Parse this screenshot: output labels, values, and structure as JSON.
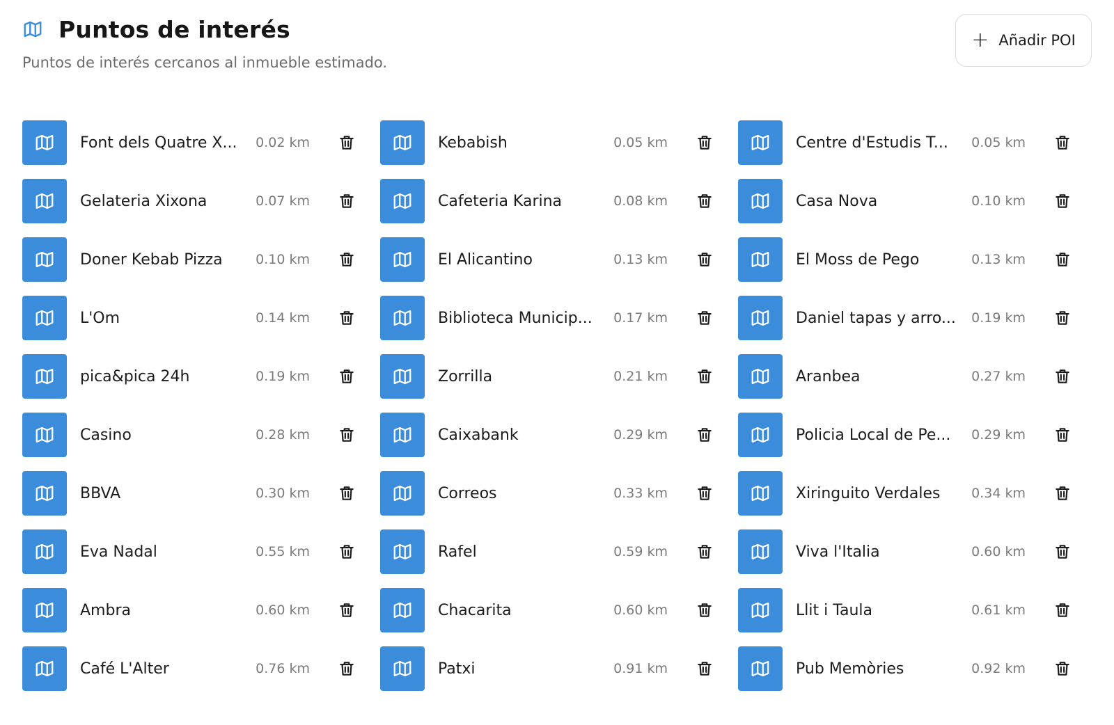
{
  "header": {
    "title": "Puntos de interés",
    "title_icon": "map-icon",
    "subtitle": "Puntos de interés cercanos al inmueble estimado.",
    "add_button_label": "Añadir POI"
  },
  "colors": {
    "accent": "#3b8ddb",
    "text": "#1a1a1a",
    "muted": "#7a7a7a"
  },
  "pois": [
    {
      "name": "Font dels Quatre X...",
      "distance": "0.02 km"
    },
    {
      "name": "Kebabish",
      "distance": "0.05 km"
    },
    {
      "name": "Centre d'Estudis T...",
      "distance": "0.05 km"
    },
    {
      "name": "Gelateria Xixona",
      "distance": "0.07 km"
    },
    {
      "name": "Cafeteria Karina",
      "distance": "0.08 km"
    },
    {
      "name": "Casa Nova",
      "distance": "0.10 km"
    },
    {
      "name": "Doner Kebab Pizza",
      "distance": "0.10 km"
    },
    {
      "name": "El Alicantino",
      "distance": "0.13 km"
    },
    {
      "name": "El Moss de Pego",
      "distance": "0.13 km"
    },
    {
      "name": "L'Om",
      "distance": "0.14 km"
    },
    {
      "name": "Biblioteca Municip...",
      "distance": "0.17 km"
    },
    {
      "name": "Daniel tapas y arro...",
      "distance": "0.19 km"
    },
    {
      "name": "pica&pica 24h",
      "distance": "0.19 km"
    },
    {
      "name": "Zorrilla",
      "distance": "0.21 km"
    },
    {
      "name": "Aranbea",
      "distance": "0.27 km"
    },
    {
      "name": "Casino",
      "distance": "0.28 km"
    },
    {
      "name": "Caixabank",
      "distance": "0.29 km"
    },
    {
      "name": "Policia Local de Pe...",
      "distance": "0.29 km"
    },
    {
      "name": "BBVA",
      "distance": "0.30 km"
    },
    {
      "name": "Correos",
      "distance": "0.33 km"
    },
    {
      "name": "Xiringuito Verdales",
      "distance": "0.34 km"
    },
    {
      "name": "Eva Nadal",
      "distance": "0.55 km"
    },
    {
      "name": "Rafel",
      "distance": "0.59 km"
    },
    {
      "name": "Viva l'Italia",
      "distance": "0.60 km"
    },
    {
      "name": "Ambra",
      "distance": "0.60 km"
    },
    {
      "name": "Chacarita",
      "distance": "0.60 km"
    },
    {
      "name": "Llit i Taula",
      "distance": "0.61 km"
    },
    {
      "name": "Café L'Alter",
      "distance": "0.76 km"
    },
    {
      "name": "Patxi",
      "distance": "0.91 km"
    },
    {
      "name": "Pub Memòries",
      "distance": "0.92 km"
    }
  ]
}
